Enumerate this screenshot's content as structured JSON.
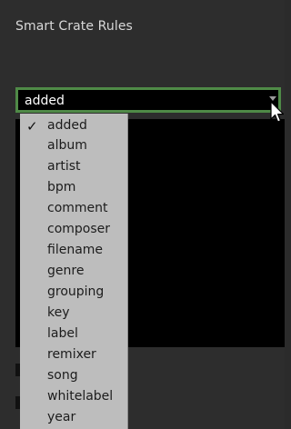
{
  "panel": {
    "title": "Smart Crate Rules"
  },
  "combo": {
    "value": "added"
  },
  "dropdown": {
    "selected": "added",
    "check_glyph": "✓",
    "items": [
      "added",
      "album",
      "artist",
      "bpm",
      "comment",
      "composer",
      "filename",
      "genre",
      "grouping",
      "key",
      "label",
      "remixer",
      "song",
      "whitelabel",
      "year"
    ]
  },
  "colors": {
    "accent_border": "#4f8a47",
    "dropdown_bg": "#bdbdbd",
    "panel_bg": "#2d2d2d"
  }
}
